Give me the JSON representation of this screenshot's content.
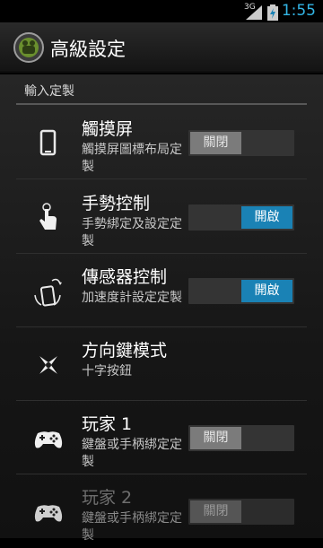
{
  "status": {
    "network": "3G",
    "time": "1:55"
  },
  "header": {
    "title": "高級設定"
  },
  "section": {
    "title": "輸入定製"
  },
  "items": [
    {
      "title": "觸摸屏",
      "summary": "觸摸屏圖標布局定製",
      "toggle": "關閉",
      "state": "off",
      "icon": "phone-icon"
    },
    {
      "title": "手勢控制",
      "summary": "手勢綁定及設定定製",
      "toggle": "開啟",
      "state": "on",
      "icon": "gesture-icon"
    },
    {
      "title": "傳感器控制",
      "summary": "加速度計設定定製",
      "toggle": "開啟",
      "state": "on",
      "icon": "sensor-icon"
    },
    {
      "title": "方向鍵模式",
      "summary": "十字按鈕",
      "icon": "dpad-icon"
    },
    {
      "title": "玩家 1",
      "summary": "鍵盤或手柄綁定定製",
      "toggle": "關閉",
      "state": "off",
      "icon": "gamepad-icon"
    },
    {
      "title": "玩家 2",
      "summary": "鍵盤或手柄綁定定製",
      "toggle": "關閉",
      "state": "off",
      "icon": "gamepad-icon",
      "disabled": true
    }
  ],
  "colors": {
    "accent": "#33b5e5",
    "toggle_on": "#1a82b5",
    "toggle_off": "#7b7b7b"
  }
}
